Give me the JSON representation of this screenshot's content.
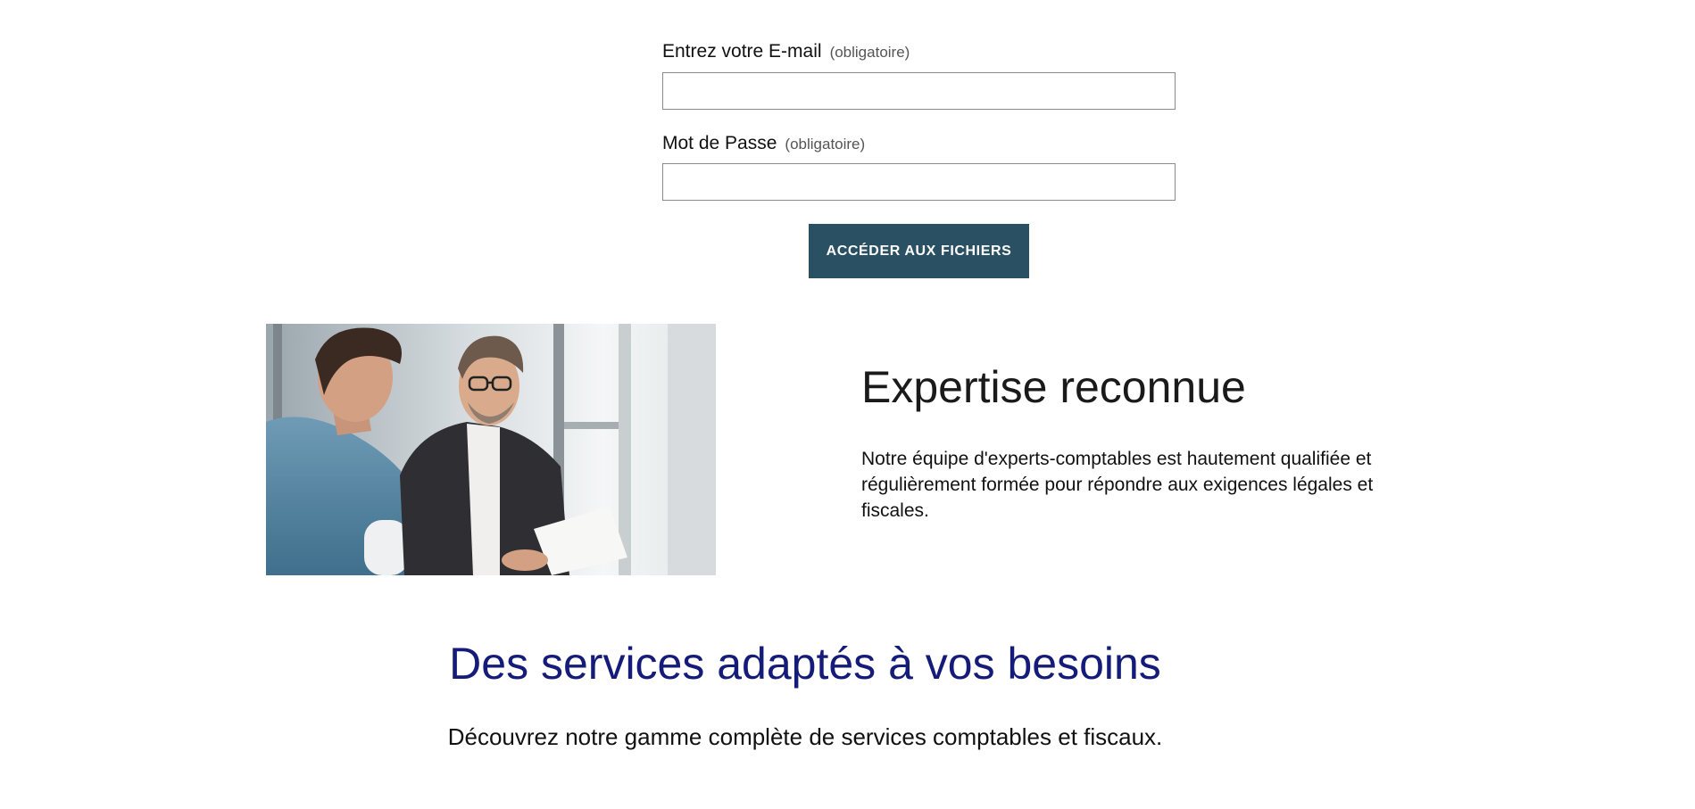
{
  "login_form": {
    "email_label": "Entrez votre E-mail",
    "email_required": "(obligatoire)",
    "email_value": "",
    "password_label": "Mot de Passe",
    "password_required": "(obligatoire)",
    "password_value": "",
    "submit_label": "Accéder aux fichiers",
    "submit_color": "#2a5063"
  },
  "feature": {
    "image_alt": "",
    "title": "Expertise reconnue",
    "text": "Notre équipe d'experts-comptables est hautement qualifiée et régulièrement formée pour répondre aux exigences légales et fiscales."
  },
  "services": {
    "title": "Des services adaptés à vos besoins",
    "subtitle": "Découvrez notre gamme complète de services comptables et fiscaux.",
    "title_color": "#141b78"
  }
}
